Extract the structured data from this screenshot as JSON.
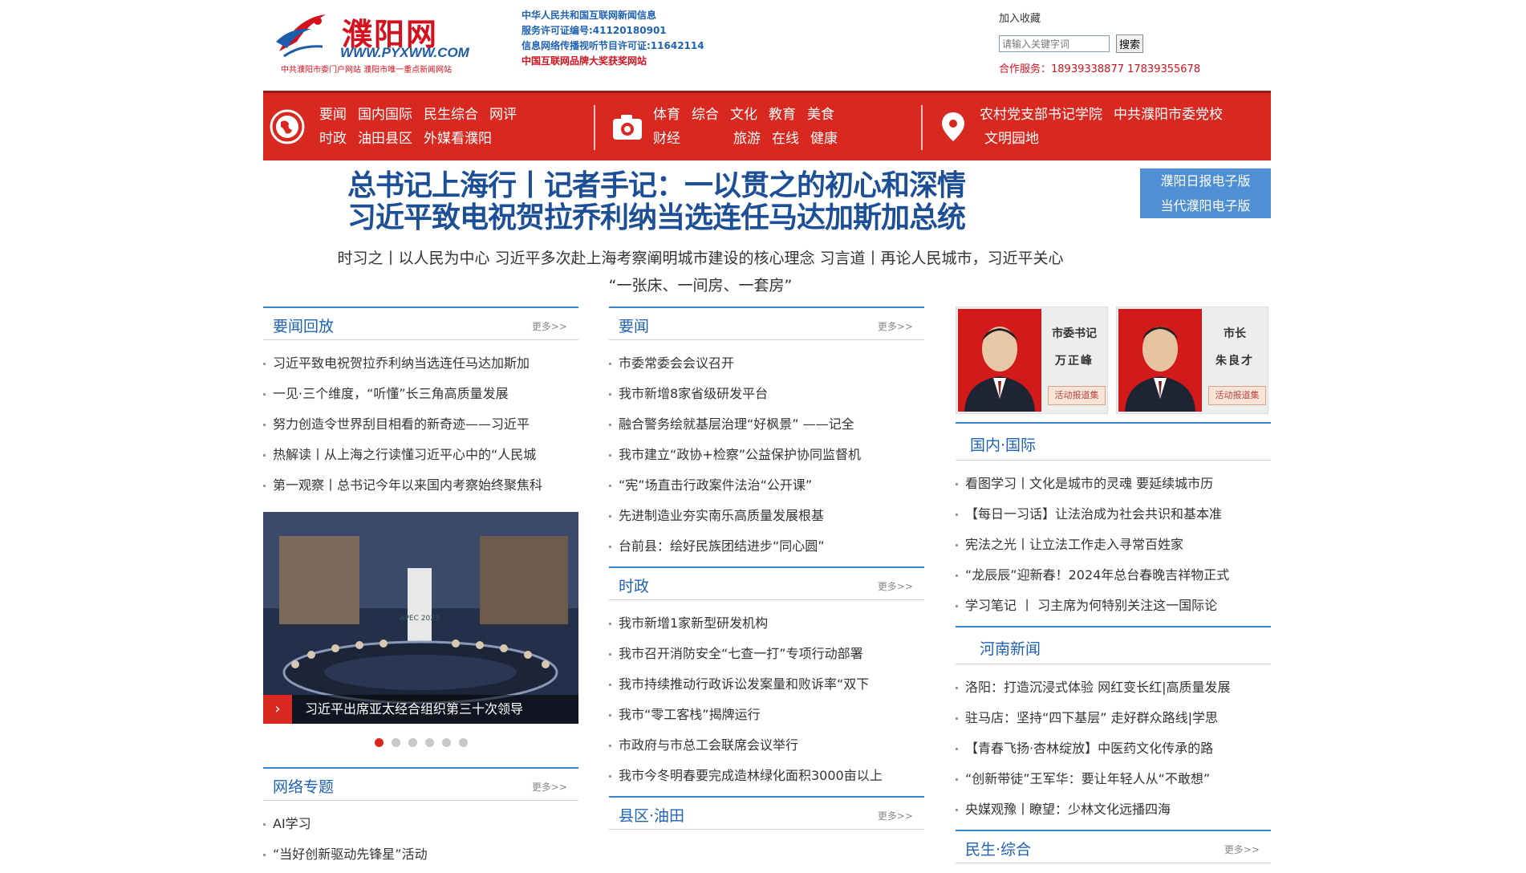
{
  "header": {
    "logo_text": "濮阳网",
    "logo_url": "WWW.PYXWW.COM",
    "logo_tagline": "中共濮阳市委门户网站  濮阳市唯一重点新闻网站",
    "license_lines": [
      "中华人民共和国互联网新闻信息",
      "服务许可证编号:41120180901",
      "信息网络传播视听节目许可证:11642114",
      "中国互联网品牌大奖获奖网站"
    ],
    "favorite": "加入收藏",
    "search_placeholder": "请输入关键字词",
    "search_button": "搜索",
    "cooperation": "合作服务：18939338877 17839355678"
  },
  "nav": {
    "group1_row1": [
      "要闻",
      "国内国际",
      "民生综合",
      "网评"
    ],
    "group1_row2": [
      "时政",
      "油田县区",
      "外媒看濮阳"
    ],
    "group2_row1": [
      "体育",
      "综合",
      "文化",
      "教育",
      "美食"
    ],
    "group2_row2": [
      "财经",
      "旅游",
      "在线",
      "健康"
    ],
    "group3_row1": [
      "农村党支部书记学院",
      "中共濮阳市委党校"
    ],
    "group3_row2": [
      "文明园地"
    ]
  },
  "headline": {
    "line1": "总书记上海行丨记者手记：一以贯之的初心和深情",
    "line2": "习近平致电祝贺拉乔利纳当选连任马达加斯加总统"
  },
  "epaper": [
    "濮阳日报电子版",
    "当代濮阳电子版"
  ],
  "subheadline": {
    "line1": "时习之丨以人民为中心  习近平多次赴上海考察阐明城市建设的核心理念  习言道丨再论人民城市，习近平关心",
    "line2": "“一张床、一间房、一套房”"
  },
  "more_label": "更多>>",
  "col1": {
    "title": "要闻回放",
    "items": [
      "习近平致电祝贺拉乔利纳当选连任马达加斯加",
      "一见·三个维度，“听懂”长三角高质量发展",
      "努力创造令世界刮目相看的新奇迹——习近平",
      "热解读丨从上海之行读懂习近平心中的“人民城",
      "第一观察丨总书记今年以来国内考察始终聚焦科"
    ],
    "slide_caption": "习近平出席亚太经合组织第三十次领导",
    "slide_arrow": "›",
    "slide_banner": "APEC 2023",
    "slide_count": 6,
    "slide_active": 0,
    "topics_title": "网络专题",
    "topics_items": [
      "AI学习",
      "“当好创新驱动先锋星”活动"
    ]
  },
  "col2": {
    "yaowen_title": "要闻",
    "yaowen_items": [
      "市委常委会会议召开",
      "我市新增8家省级研发平台",
      "融合警务绘就基层治理“好枫景” ——记全",
      "我市建立“政协+检察”公益保护协同监督机",
      "“宪”场直击行政案件法治“公开课”",
      "先进制造业夯实南乐高质量发展根基",
      "台前县：绘好民族团结进步“同心圆”"
    ],
    "shizheng_title": "时政",
    "shizheng_items": [
      "我市新增1家新型研发机构",
      "我市召开消防安全“七查一打”专项行动部署",
      "我市持续推动行政诉讼发案量和败诉率“双下",
      "我市“零工客栈”揭牌运行",
      "市政府与市总工会联席会议举行",
      "我市今冬明春要完成造林绿化面积3000亩以上"
    ],
    "county_title": "县区·油田"
  },
  "col3": {
    "leaders": [
      {
        "role": "市委书记",
        "name": "万正峰",
        "link": "活动报道集"
      },
      {
        "role": "市长",
        "name": "朱良才",
        "link": "活动报道集"
      }
    ],
    "intl_title": "国内·国际",
    "intl_items": [
      "看图学习丨文化是城市的灵魂 要延续城市历",
      "【每日一习话】让法治成为社会共识和基本准",
      "宪法之光丨让立法工作走入寻常百姓家",
      "“龙辰辰”迎新春！2024年总台春晚吉祥物正式",
      "学习笔记 丨 习主席为何特别关注这一国际论"
    ],
    "henan_title": "河南新闻",
    "henan_items": [
      "洛阳：打造沉浸式体验 网红变长红|高质量发展",
      "驻马店：坚持“四下基层” 走好群众路线|学思",
      "【青春飞扬·杏林绽放】中医药文化传承的路",
      "“创新带徒”王军华：要让年轻人从“不敢想”",
      "央媒观豫丨瞭望：少林文化远播四海"
    ],
    "minsheng_title": "民生·综合"
  },
  "colors": {
    "brand_red": "#d9281f",
    "link_blue": "#1f62b4",
    "headline_blue": "#1d4f96"
  }
}
